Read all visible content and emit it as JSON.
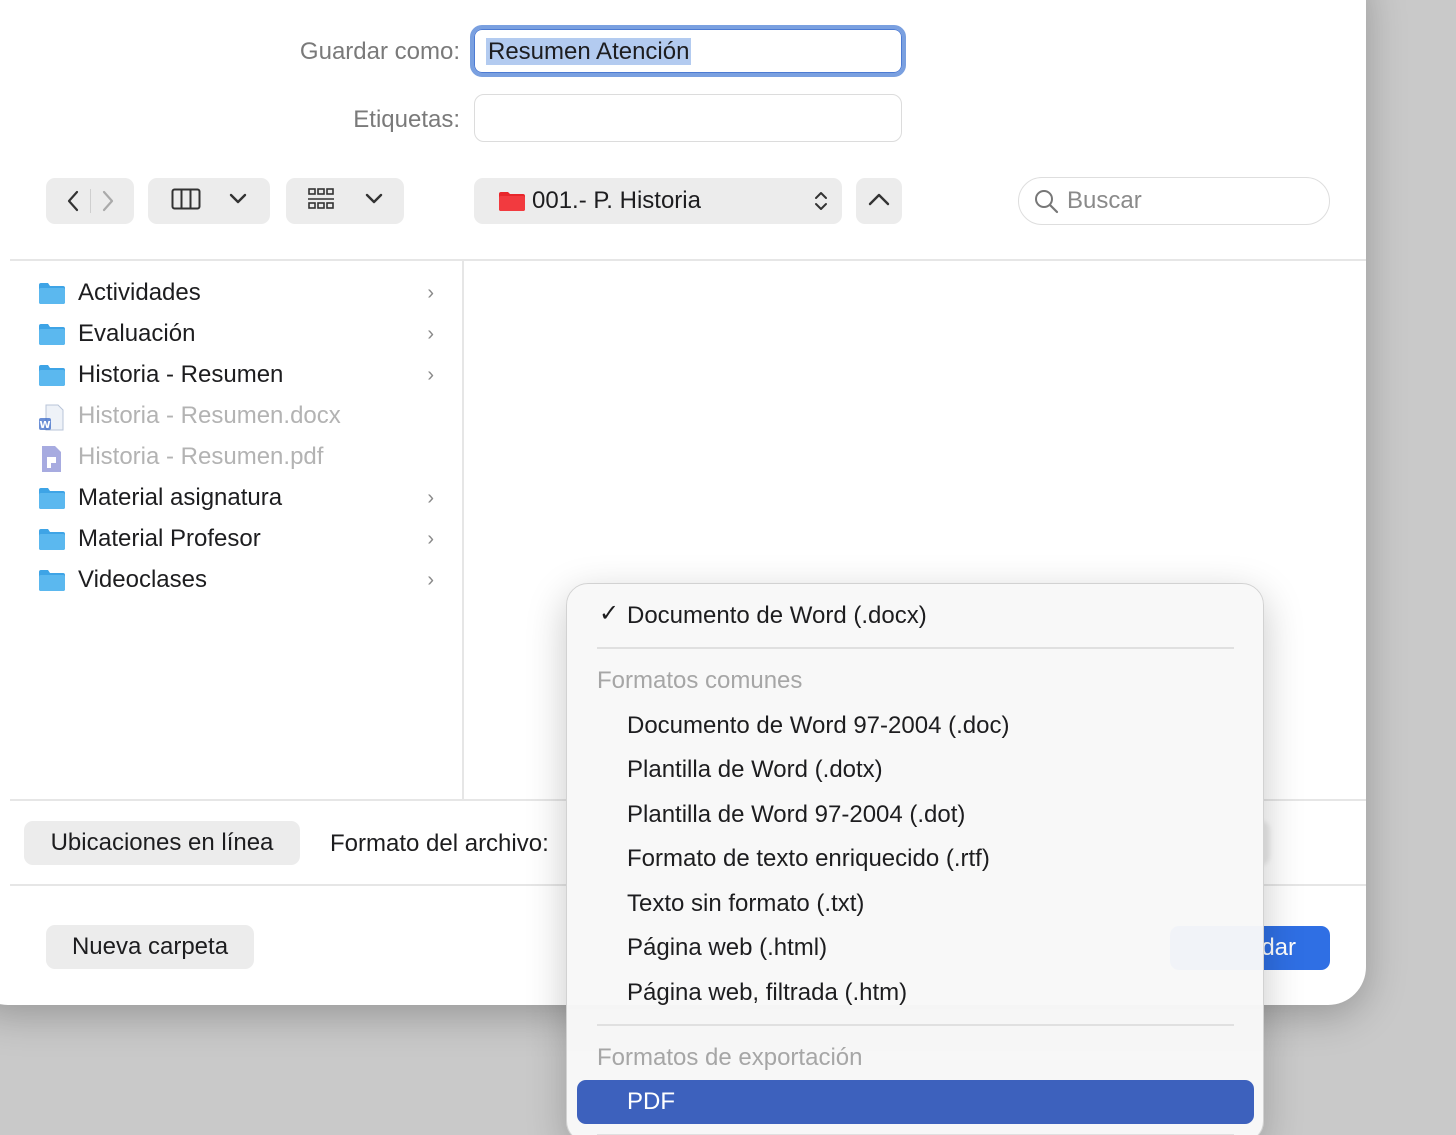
{
  "form": {
    "save_as_label": "Guardar como:",
    "save_as_value": "Resumen Atención",
    "tags_label": "Etiquetas:"
  },
  "toolbar": {
    "location": "001.- P. Historia",
    "search_placeholder": "Buscar"
  },
  "files": [
    {
      "name": "Actividades",
      "type": "folder",
      "enabled": true
    },
    {
      "name": "Evaluación",
      "type": "folder",
      "enabled": true
    },
    {
      "name": "Historia - Resumen",
      "type": "folder",
      "enabled": true
    },
    {
      "name": "Historia - Resumen.docx",
      "type": "docx",
      "enabled": false
    },
    {
      "name": "Historia - Resumen.pdf",
      "type": "pdf",
      "enabled": false
    },
    {
      "name": "Material asignatura",
      "type": "folder",
      "enabled": true
    },
    {
      "name": "Material Profesor",
      "type": "folder",
      "enabled": true
    },
    {
      "name": "Videoclases",
      "type": "folder",
      "enabled": true
    }
  ],
  "bottom": {
    "online_locations": "Ubicaciones en línea",
    "file_format_label": "Formato del archivo:",
    "new_folder": "Nueva carpeta",
    "save_partial": "dar"
  },
  "format_menu": {
    "current": "Documento de Word (.docx)",
    "common_header": "Formatos comunes",
    "common": [
      "Documento de Word 97-2004 (.doc)",
      "Plantilla de Word (.dotx)",
      "Plantilla de Word 97-2004 (.dot)",
      "Formato de texto enriquecido (.rtf)",
      "Texto sin formato (.txt)",
      "Página web (.html)",
      "Página web, filtrada (.htm)"
    ],
    "export_header": "Formatos de exportación",
    "export_selected": "PDF"
  },
  "colors": {
    "accent": "#2f6fe4",
    "menu_selection": "#3d61bd",
    "folder": "#5bb8ef",
    "location_folder": "#e8262b"
  }
}
